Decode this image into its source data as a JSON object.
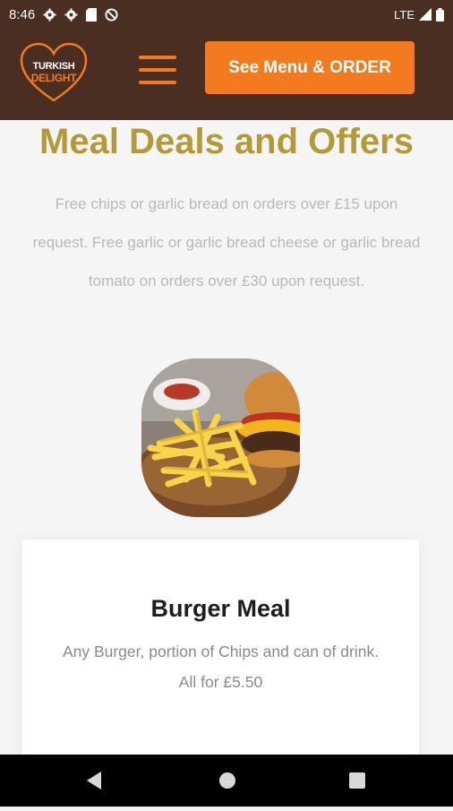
{
  "status_bar": {
    "time": "8:46",
    "network": "LTE",
    "icons": [
      "settings-icon",
      "settings-icon",
      "sd-card-icon",
      "no-disturb-icon",
      "signal-icon",
      "battery-icon"
    ]
  },
  "header": {
    "logo": {
      "line1": "TURKISH",
      "line2": "DELIGHT"
    },
    "menu_icon": "hamburger-menu-icon",
    "order_button_label": "See Menu & ORDER"
  },
  "main": {
    "title": "Meal Deals and Offers",
    "intro": "Free chips or garlic bread on orders over £15 upon request. Free garlic or garlic bread cheese or garlic bread tomato on orders over £30 upon request.",
    "deal": {
      "image": "burger-and-fries-photo",
      "title": "Burger Meal",
      "description": "Any Burger, portion of Chips and can of drink. All for £5.50"
    }
  },
  "nav_bar": {
    "buttons": [
      "back-icon",
      "home-icon",
      "recents-icon"
    ]
  },
  "colors": {
    "header_bg": "#4a2e22",
    "accent_orange": "#f37a1f",
    "title_gold": "#b49a36",
    "page_bg": "#f5f5f5"
  }
}
